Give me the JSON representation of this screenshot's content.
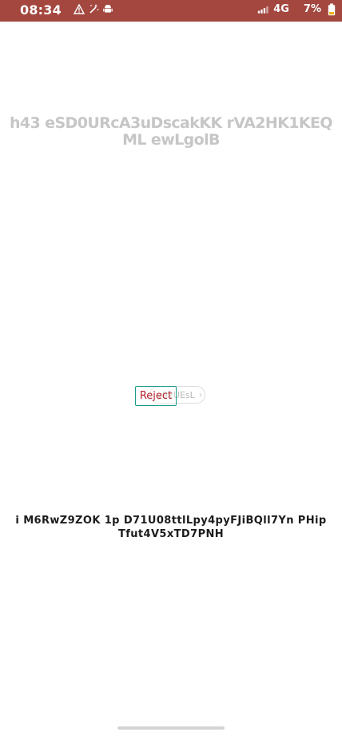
{
  "status_bar": {
    "time": "08:34",
    "network": "4G",
    "battery": "7%",
    "background_color": "#a3473f",
    "icons": [
      "warning-icon",
      "magic-wand-icon",
      "android-icon",
      "signal-icon",
      "battery-low-icon"
    ]
  },
  "main": {
    "headline": "h43 eSD0URcA3uDscakKK rVA2HK1KEQ ML ewLgolB",
    "pill_label": "y92UEsL",
    "reject_label": "Reject",
    "bottom_text": "i M6RwZ9ZOK 1p D71U08ttlLpy4pyFJiBQll7Yn PHip Tfut4V5xTD7PNH"
  },
  "colors": {
    "reject_border": "#1a9b8a",
    "reject_text": "#b3202a",
    "headline_text": "#c6c6c6"
  }
}
